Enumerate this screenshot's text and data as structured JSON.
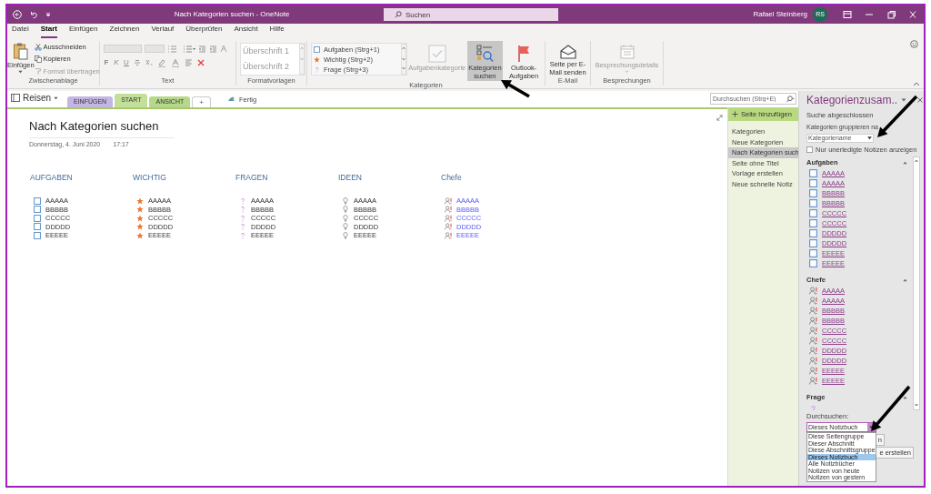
{
  "window": {
    "title": "Nach Kategorien suchen - OneNote",
    "search_placeholder": "Suchen",
    "user": "Rafael Steinberg",
    "avatar": "RS"
  },
  "menu_tabs": [
    {
      "label": "Datei",
      "selected": false
    },
    {
      "label": "Start",
      "selected": true
    },
    {
      "label": "Einfügen",
      "selected": false
    },
    {
      "label": "Zeichnen",
      "selected": false
    },
    {
      "label": "Verlauf",
      "selected": false
    },
    {
      "label": "Überprüfen",
      "selected": false
    },
    {
      "label": "Ansicht",
      "selected": false
    },
    {
      "label": "Hilfe",
      "selected": false
    }
  ],
  "ribbon": {
    "clipboard": {
      "label": "Zwischenablage",
      "paste": "Einfügen",
      "actions": [
        {
          "label": "Ausschneiden",
          "kind": "cut",
          "disabled": false
        },
        {
          "label": "Kopieren",
          "kind": "copy",
          "disabled": false
        },
        {
          "label": "Format übertragen",
          "kind": "brush",
          "disabled": true
        }
      ]
    },
    "text": {
      "label": "Text",
      "format_buttons": [
        "F",
        "K",
        "U"
      ]
    },
    "styles": {
      "label": "Formatvorlagen",
      "items": [
        "Überschrift 1",
        "Überschrift 2"
      ]
    },
    "tags": {
      "label": "Kategorien",
      "items": [
        {
          "label": "Aufgaben (Strg+1)",
          "kind": "checkbox"
        },
        {
          "label": "Wichtig (Strg+2)",
          "kind": "star"
        },
        {
          "label": "Frage (Strg+3)",
          "kind": "question"
        }
      ],
      "buttons": [
        {
          "label": "Aufgabenkategorie",
          "kind": "check",
          "disabled": true,
          "selected": false
        },
        {
          "label": "Kategorien suchen",
          "kind": "find",
          "disabled": false,
          "selected": true
        },
        {
          "label": "Outlook-Aufgaben",
          "kind": "flag",
          "disabled": false,
          "selected": false
        }
      ]
    },
    "email": {
      "label": "E-Mail",
      "button": "Seite per E-Mail senden"
    },
    "meetings": {
      "label": "Besprechungen",
      "button": "Besprechungsdetails",
      "disabled": true
    }
  },
  "notebook": {
    "name": "Reisen",
    "sections": [
      {
        "label": "EINFÜGEN",
        "color": "#c4b6e2",
        "selected": false
      },
      {
        "label": "START",
        "color": "#c3e09a",
        "selected": true
      },
      {
        "label": "ANSICHT",
        "color": "#b5d88a",
        "selected": false
      }
    ],
    "add_section": "+",
    "sync_status": "Fertig"
  },
  "page": {
    "title": "Nach Kategorien suchen",
    "date": "Donnerstag, 4. Juni 2020",
    "time": "17:17",
    "columns": [
      {
        "heading": "AUFGABEN",
        "kind": "checkbox",
        "linked": false,
        "items": [
          "AAAAA",
          "BBBBB",
          "CCCCC",
          "DDDDD",
          "EEEEE"
        ]
      },
      {
        "heading": "WICHTIG",
        "kind": "star",
        "linked": false,
        "items": [
          "AAAAA",
          "BBBBB",
          "CCCCC",
          "DDDDD",
          "EEEEE"
        ]
      },
      {
        "heading": "FRAGEN",
        "kind": "question",
        "linked": false,
        "items": [
          "AAAAA",
          "BBBBB",
          "CCCCC",
          "DDDDD",
          "EEEEE"
        ]
      },
      {
        "heading": "IDEEN",
        "kind": "bulb",
        "linked": false,
        "items": [
          "AAAAA",
          "BBBBB",
          "CCCCC",
          "DDDDD",
          "EEEEE"
        ]
      },
      {
        "heading": "Chefe",
        "kind": "contact",
        "linked": true,
        "items": [
          "AAAAA",
          "BBBBB",
          "CCCCC",
          "DDDDD",
          "EEEEE"
        ]
      }
    ]
  },
  "page_search": {
    "placeholder": "Durchsuchen (Strg+E)"
  },
  "pages": {
    "add": "Seite hinzufügen",
    "items": [
      {
        "label": "Kategorien",
        "selected": false
      },
      {
        "label": "Neue Kategorien",
        "selected": false
      },
      {
        "label": "Nach Kategorien such",
        "selected": true
      },
      {
        "label": "Seite ohne Titel",
        "selected": false
      },
      {
        "label": "Vorlage erstellen",
        "selected": false
      },
      {
        "label": "Neue schnelle Notiz",
        "selected": false
      }
    ]
  },
  "task_pane": {
    "title": "Kategorienzusam..",
    "status": "Suche abgeschlossen",
    "group_by_label": "Kategorien gruppieren na",
    "group_by_value": "Kategoriename",
    "only_open": {
      "label": "Nur unerledigte Notizen anzeigen",
      "checked": false
    },
    "groups": [
      {
        "heading": "Aufgaben",
        "kind": "checkbox",
        "items": [
          "AAAAA",
          "AAAAA",
          "BBBBB",
          "BBBBB",
          "CCCCC",
          "CCCCC",
          "DDDDD",
          "DDDDD",
          "EEEEE",
          "EEEEE"
        ]
      },
      {
        "heading": "Chefe",
        "kind": "contact",
        "items": [
          "AAAAA",
          "AAAAA",
          "BBBBB",
          "BBBBB",
          "CCCCC",
          "CCCCC",
          "DDDDD",
          "DDDDD",
          "EEEEE",
          "EEEEE"
        ]
      },
      {
        "heading": "Frage",
        "kind": "question"
      }
    ],
    "scope_label": "Durchsuchen:",
    "scope_value": "Dieses Notizbuch",
    "scope_options": [
      {
        "label": "Diese Seitengruppe",
        "selected": false
      },
      {
        "label": "Dieser Abschnitt",
        "selected": false
      },
      {
        "label": "Diese Abschnittsgruppe",
        "selected": false
      },
      {
        "label": "Dieses Notizbuch",
        "selected": true
      },
      {
        "label": "Alle Notizbücher",
        "selected": false
      },
      {
        "label": "Notizen von heute",
        "selected": false
      },
      {
        "label": "Notizen von gestern",
        "selected": false
      }
    ],
    "hidden_buttons": [
      "n",
      "e erstellen"
    ]
  }
}
